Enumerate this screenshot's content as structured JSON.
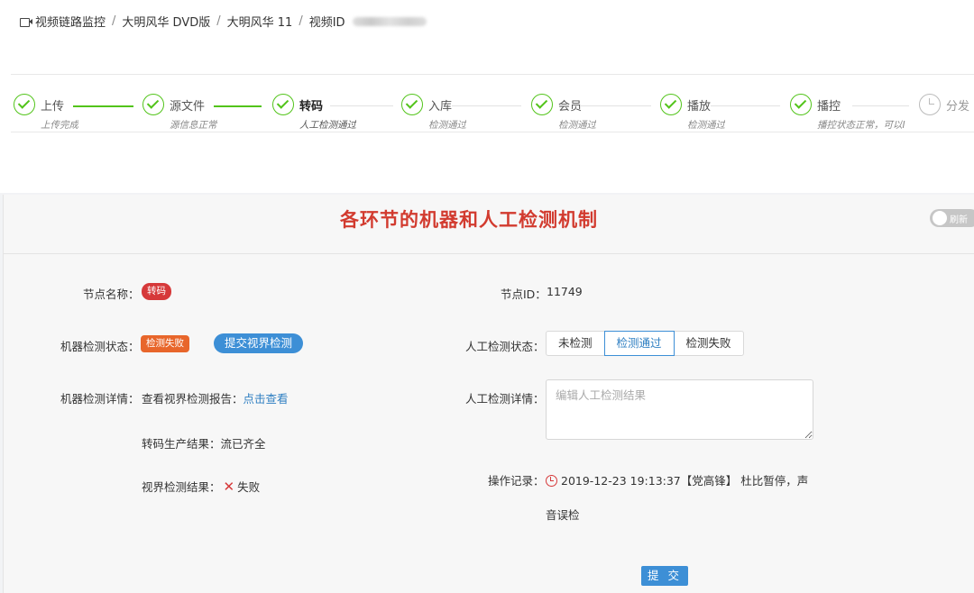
{
  "breadcrumb": {
    "items": [
      "视频链路监控",
      "大明风华 DVD版",
      "大明风华 11",
      "视频ID"
    ],
    "separator": "/"
  },
  "steps": [
    {
      "title": "上传",
      "desc": "上传完成",
      "status": "done"
    },
    {
      "title": "源文件",
      "desc": "源信息正常",
      "status": "done"
    },
    {
      "title": "转码",
      "desc": "人工检测通过",
      "status": "active"
    },
    {
      "title": "入库",
      "desc": "检测通过",
      "status": "done"
    },
    {
      "title": "会员",
      "desc": "检测通过",
      "status": "done"
    },
    {
      "title": "播放",
      "desc": "检测通过",
      "status": "done"
    },
    {
      "title": "播控",
      "desc": "播控状态正常，可以I",
      "status": "done"
    },
    {
      "title": "分发",
      "desc": "",
      "status": "wait"
    }
  ],
  "card": {
    "title": "各环节的机器和人工检测机制",
    "refresh_label": "刷新"
  },
  "node": {
    "name_label": "节点名称：",
    "name_tag": "转码",
    "id_label": "节点ID：",
    "id_value": "11749"
  },
  "machine": {
    "status_label": "机器检测状态：",
    "status_tag": "检测失败",
    "submit_check_button": "提交视界检测",
    "detail_label": "机器检测详情：",
    "report_text": "查看视界检测报告：",
    "report_link": "点击查看",
    "transcode_result": "转码生产结果：流已齐全",
    "vision_result_label": "视界检测结果：",
    "vision_result_value": "失败"
  },
  "manual": {
    "status_label": "人工检测状态：",
    "options": [
      "未检测",
      "检测通过",
      "检测失败"
    ],
    "selected": "检测通过",
    "detail_label": "人工检测详情：",
    "detail_placeholder": "编辑人工检测结果",
    "detail_value": "",
    "log_label": "操作记录：",
    "log_line1": "2019-12-23 19:13:37【党高锋】 杜比暂停，声",
    "log_line2": "音误检"
  },
  "submit_label": "提 交",
  "colors": {
    "success": "#52c41a",
    "primary": "#3d8fd6",
    "danger": "#d6393a",
    "warning": "#e8662b",
    "title_red": "#d23b2f"
  }
}
